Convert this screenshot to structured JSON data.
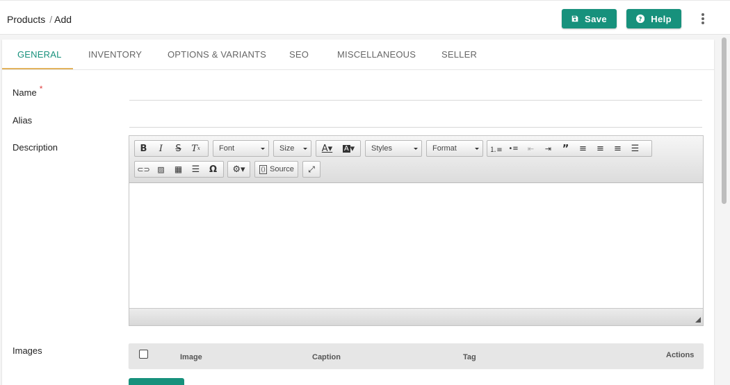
{
  "breadcrumb": {
    "parent": "Products",
    "separator": "/",
    "current": "Add"
  },
  "header": {
    "save_label": "Save",
    "help_label": "Help"
  },
  "colors": {
    "accent": "#17917c",
    "tab_underline": "#e2b25c",
    "required": "#e04040"
  },
  "tabs": [
    {
      "label": "GENERAL",
      "active": true
    },
    {
      "label": "INVENTORY",
      "active": false
    },
    {
      "label": "OPTIONS & VARIANTS",
      "active": false
    },
    {
      "label": "SEO",
      "active": false
    },
    {
      "label": "MISCELLANEOUS",
      "active": false
    },
    {
      "label": "SELLER",
      "active": false
    }
  ],
  "form": {
    "name_label": "Name",
    "required_mark": "*",
    "alias_label": "Alias",
    "description_label": "Description",
    "images_label": "Images"
  },
  "editor": {
    "font_label": "Font",
    "size_label": "Size",
    "styles_label": "Styles",
    "format_label": "Format",
    "source_label": "Source",
    "icons": [
      "bold-icon",
      "italic-icon",
      "strike-icon",
      "remove-format-icon",
      "text-color-icon",
      "bg-color-icon",
      "numbered-list-icon",
      "bulleted-list-icon",
      "outdent-icon",
      "indent-icon",
      "blockquote-icon",
      "align-left-icon",
      "align-center-icon",
      "align-right-icon",
      "justify-icon",
      "link-icon",
      "image-icon",
      "table-icon",
      "horizontal-rule-icon",
      "special-char-icon",
      "settings-icon",
      "source-icon",
      "maximize-icon"
    ]
  },
  "images_table": {
    "columns": [
      "Image",
      "Caption",
      "Tag",
      "Actions"
    ]
  }
}
